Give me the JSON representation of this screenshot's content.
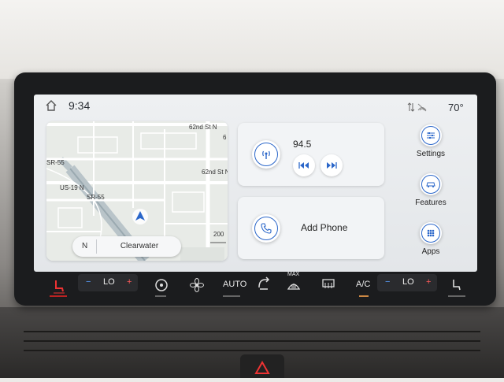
{
  "status_bar": {
    "time": "9:34",
    "temperature": "70°",
    "home_icon": "home-icon",
    "signal_icon": "signal-icon"
  },
  "map": {
    "labels": [
      "62nd St N",
      "6",
      "SR-55",
      "62nd St N",
      "US-19 N",
      "SR-55",
      "200"
    ],
    "heading": "N",
    "location": "Clearwater"
  },
  "radio": {
    "frequency": "94.5",
    "icon": "radio-icon",
    "prev_icon": "skip-back-icon",
    "next_icon": "skip-forward-icon"
  },
  "phone": {
    "label": "Add Phone",
    "icon": "phone-icon"
  },
  "side_menu": [
    {
      "label": "Settings",
      "icon": "sliders-icon"
    },
    {
      "label": "Features",
      "icon": "car-icon"
    },
    {
      "label": "Apps",
      "icon": "grid-icon"
    }
  ],
  "climate": {
    "left_temp": "LO",
    "right_temp": "LO",
    "auto_label": "AUTO",
    "max_label": "MAX",
    "ac_label": "A/C",
    "minus": "−",
    "plus": "+"
  },
  "colors": {
    "accent": "#2a66c9",
    "screen_bg": "#e8ebee",
    "bezel": "#1b1c1e"
  }
}
